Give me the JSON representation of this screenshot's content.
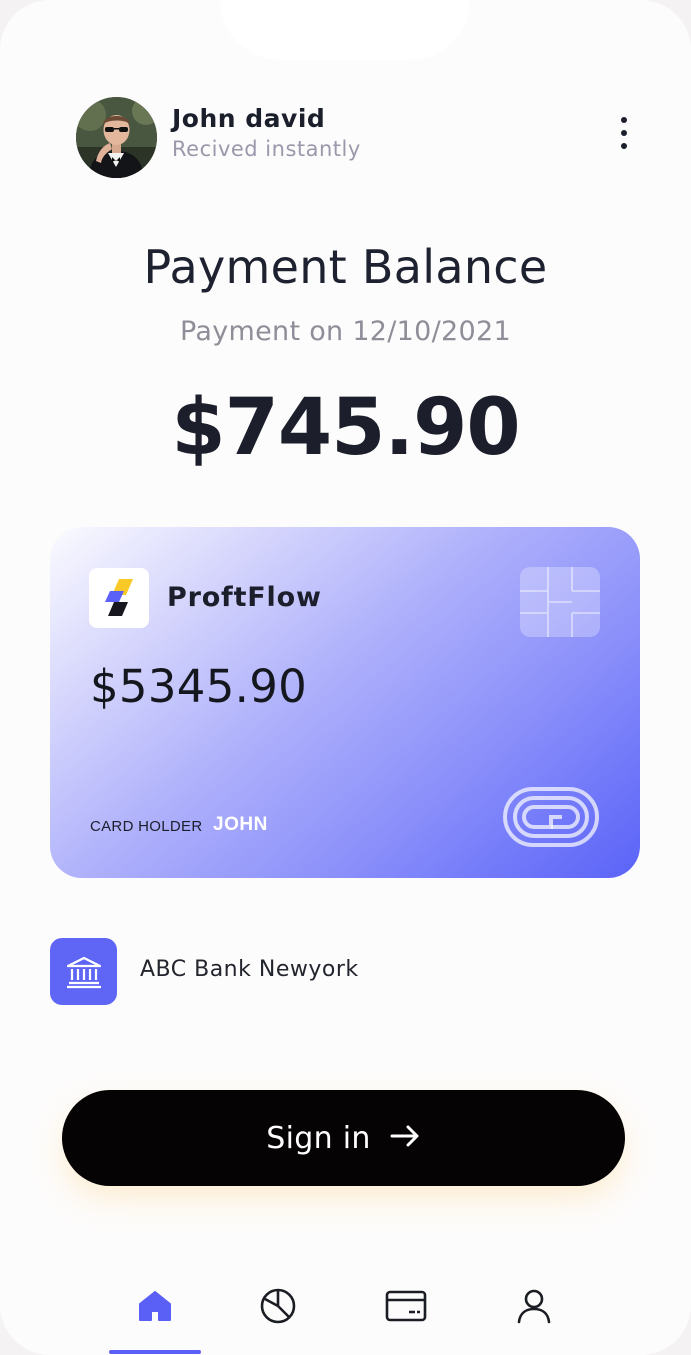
{
  "header": {
    "user_name": "John david",
    "user_status": "Recived instantly",
    "menu_icon": "more-vertical-icon"
  },
  "balance": {
    "title": "Payment Balance",
    "date_text": "Payment on 12/10/2021",
    "amount": "$745.90"
  },
  "card": {
    "brand_name": "ProftFlow",
    "balance": "$5345.90",
    "holder_label": "CARD HOLDER",
    "holder_name": "JOHN",
    "chip_icon": "card-chip-icon",
    "network_icon": "card-network-logo-icon"
  },
  "bank": {
    "name": "ABC Bank Newyork",
    "icon": "bank-icon"
  },
  "signin": {
    "label": "Sign in",
    "icon": "arrow-right-icon"
  },
  "nav": {
    "items": [
      {
        "icon": "home-icon",
        "active": true
      },
      {
        "icon": "pie-chart-icon",
        "active": false
      },
      {
        "icon": "credit-card-icon",
        "active": false
      },
      {
        "icon": "user-icon",
        "active": false
      }
    ]
  },
  "colors": {
    "accent": "#5a60f5",
    "button_bg": "#050304",
    "title_text": "#1e2230",
    "muted_text": "#9a98aa"
  }
}
